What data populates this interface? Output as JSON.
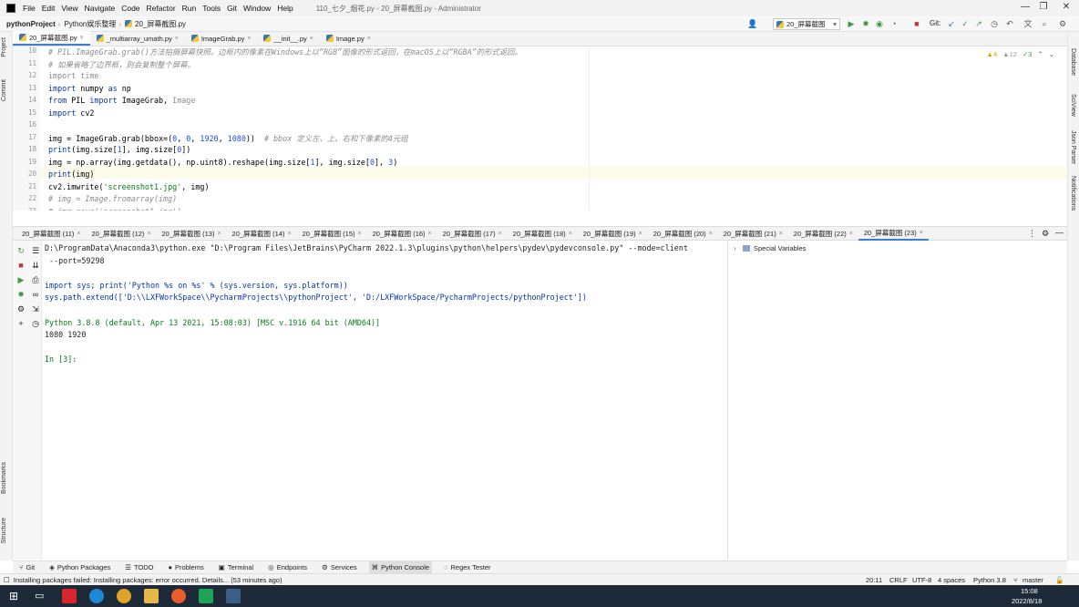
{
  "menubar": {
    "items": [
      "File",
      "Edit",
      "View",
      "Navigate",
      "Code",
      "Refactor",
      "Run",
      "Tools",
      "Git",
      "Window",
      "Help"
    ],
    "window_title": "110_七夕_烟花.py - 20_屏幕截图.py - Administrator"
  },
  "breadcrumbs": [
    "pythonProject",
    "Python娱乐整理",
    "20_屏幕截图.py"
  ],
  "toolbar": {
    "run_config": "20_屏幕截图",
    "git_label": "Git:"
  },
  "left_strip": {
    "project": "Project",
    "commit": "Commit",
    "bookmarks": "Bookmarks",
    "structure": "Structure"
  },
  "right_strip": {
    "database": "Database",
    "sciview": "SciView",
    "json_parser": "Json Parser",
    "notifications": "Notifications"
  },
  "editor_tabs": [
    "20_屏幕截图.py",
    "_multiarray_umath.py",
    "ImageGrab.py",
    "__init__.py",
    "Image.py"
  ],
  "inspections": {
    "warnings": "4",
    "weak": "12",
    "typos": "3"
  },
  "editor": {
    "line_numbers": [
      "10",
      "11",
      "12",
      "13",
      "14",
      "15",
      "16",
      "17",
      "18",
      "19",
      "20",
      "21",
      "22",
      "23"
    ],
    "lines": [
      {
        "segs": [
          {
            "t": "# PIL.ImageGrab.grab()方法拍摄屏幕快照。边框内的像素在Windows上以“RGB”图像的形式返回，在macOS上以“RGBA”的形式返回。",
            "c": "cmt"
          }
        ]
      },
      {
        "segs": [
          {
            "t": "# 如果省略了边界框，则会复制整个屏幕。",
            "c": "cmt"
          }
        ]
      },
      {
        "segs": [
          {
            "t": "import",
            "c": "unused"
          },
          {
            "t": " time",
            "c": "unused"
          }
        ]
      },
      {
        "segs": [
          {
            "t": "import",
            "c": "kw"
          },
          {
            "t": " numpy ",
            "c": ""
          },
          {
            "t": "as",
            "c": "kw"
          },
          {
            "t": " np",
            "c": ""
          }
        ]
      },
      {
        "segs": [
          {
            "t": "from",
            "c": "kw"
          },
          {
            "t": " PIL ",
            "c": ""
          },
          {
            "t": "import",
            "c": "kw"
          },
          {
            "t": " ImageGrab, ",
            "c": ""
          },
          {
            "t": "Image",
            "c": "unused"
          }
        ]
      },
      {
        "segs": [
          {
            "t": "import",
            "c": "kw"
          },
          {
            "t": " cv2",
            "c": ""
          }
        ]
      },
      {
        "segs": [
          {
            "t": "",
            "c": ""
          }
        ]
      },
      {
        "segs": [
          {
            "t": "img = ImageGrab.grab(bbox=(",
            "c": ""
          },
          {
            "t": "0",
            "c": "num"
          },
          {
            "t": ", ",
            "c": ""
          },
          {
            "t": "0",
            "c": "num"
          },
          {
            "t": ", ",
            "c": ""
          },
          {
            "t": "1920",
            "c": "num"
          },
          {
            "t": ", ",
            "c": ""
          },
          {
            "t": "1080",
            "c": "num"
          },
          {
            "t": "))  ",
            "c": ""
          },
          {
            "t": "# bbox 定义左、上、右和下像素的4元组",
            "c": "cmt"
          }
        ]
      },
      {
        "segs": [
          {
            "t": "print",
            "c": "kw"
          },
          {
            "t": "(img.size[",
            "c": ""
          },
          {
            "t": "1",
            "c": "num"
          },
          {
            "t": "], img.size[",
            "c": ""
          },
          {
            "t": "0",
            "c": "num"
          },
          {
            "t": "])",
            "c": ""
          }
        ]
      },
      {
        "segs": [
          {
            "t": "img = np.array(img.getdata(), np.uint8).reshape(img.size[",
            "c": ""
          },
          {
            "t": "1",
            "c": "num"
          },
          {
            "t": "], img.size[",
            "c": ""
          },
          {
            "t": "0",
            "c": "num"
          },
          {
            "t": "], ",
            "c": ""
          },
          {
            "t": "3",
            "c": "num"
          },
          {
            "t": ")",
            "c": ""
          }
        ]
      },
      {
        "segs": [
          {
            "t": "print",
            "c": "kw"
          },
          {
            "t": "(img)",
            "c": ""
          }
        ]
      },
      {
        "segs": [
          {
            "t": "cv2.imwrite(",
            "c": ""
          },
          {
            "t": "'screenshot1.jpg'",
            "c": "str"
          },
          {
            "t": ", img)",
            "c": ""
          }
        ]
      },
      {
        "segs": [
          {
            "t": "# img = Image.fromarray(img)",
            "c": "cmt"
          }
        ]
      },
      {
        "segs": [
          {
            "t": "# img.save('screenshot1.jpg')",
            "c": "cmt"
          }
        ]
      }
    ]
  },
  "console_tabs": [
    "20_屏幕截图 (11)",
    "20_屏幕截图 (12)",
    "20_屏幕截图 (13)",
    "20_屏幕截图 (14)",
    "20_屏幕截图 (15)",
    "20_屏幕截图 (16)",
    "20_屏幕截图 (17)",
    "20_屏幕截图 (18)",
    "20_屏幕截图 (19)",
    "20_屏幕截图 (20)",
    "20_屏幕截图 (21)",
    "20_屏幕截图 (22)",
    "20_屏幕截图 (23)"
  ],
  "console": {
    "lines": [
      {
        "t": "D:\\ProgramData\\Anaconda3\\python.exe \"D:\\Program Files\\JetBrains\\PyCharm 2022.1.3\\plugins\\python\\helpers\\pydev\\pydevconsole.py\" --mode=client",
        "c": ""
      },
      {
        "t": " --port=59298",
        "c": ""
      },
      {
        "t": "",
        "c": ""
      },
      {
        "t": "import sys; print('Python %s on %s' % (sys.version, sys.platform))",
        "c": "cl-blue"
      },
      {
        "t": "sys.path.extend(['D:\\\\LXFWorkSpace\\\\PycharmProjects\\\\pythonProject', 'D:/LXFWorkSpace/PycharmProjects/pythonProject'])",
        "c": "cl-blue"
      },
      {
        "t": "",
        "c": ""
      },
      {
        "t": "Python 3.8.8 (default, Apr 13 2021, 15:08:03) [MSC v.1916 64 bit (AMD64)]",
        "c": "cl-green"
      },
      {
        "t": "1080 1920",
        "c": ""
      },
      {
        "t": "",
        "c": ""
      },
      {
        "t": "In [3]:",
        "c": "cl-green"
      }
    ]
  },
  "variables": {
    "special": "Special Variables"
  },
  "tool_windows": [
    "Git",
    "Python Packages",
    "TODO",
    "Problems",
    "Terminal",
    "Endpoints",
    "Services",
    "Python Console",
    "Regex Tester"
  ],
  "status": {
    "message": "Installing packages failed: Installing packages: error occurred. Details... (53 minutes ago)",
    "position": "20:11",
    "line_sep": "CRLF",
    "encoding": "UTF-8",
    "indent": "4 spaces",
    "interpreter": "Python 3.8",
    "branch": "master"
  },
  "taskbar": {
    "time": "15:08",
    "date": "2022/8/18"
  }
}
